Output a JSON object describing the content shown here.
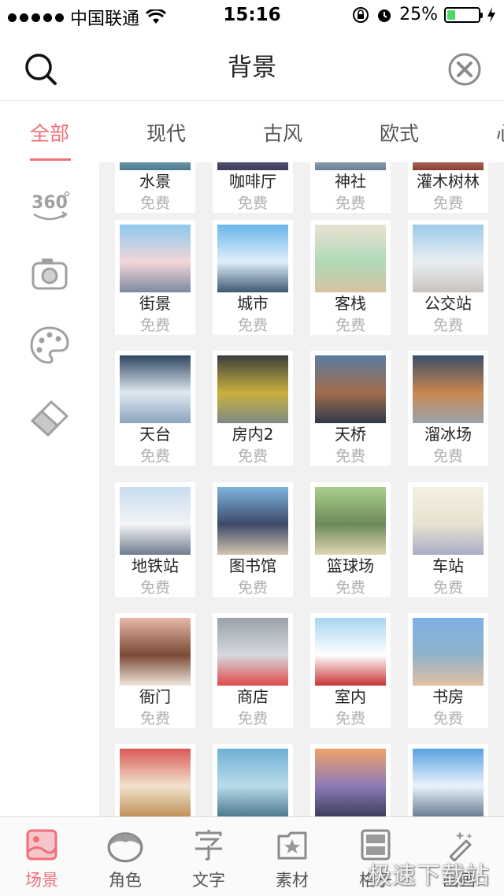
{
  "status_bar": {
    "carrier": "中国联通",
    "time": "15:16",
    "battery": "25%",
    "battery_level": 0.25
  },
  "header": {
    "title": "背景"
  },
  "tabs": [
    {
      "label": "全部",
      "active": true
    },
    {
      "label": "现代",
      "active": false
    },
    {
      "label": "古风",
      "active": false
    },
    {
      "label": "欧式",
      "active": false
    },
    {
      "label": "心",
      "active": false
    }
  ],
  "sidebar": {
    "icons": [
      "360-view-icon",
      "camera-icon",
      "palette-icon",
      "eraser-icon"
    ],
    "label_360": "360"
  },
  "rows": [
    [
      {
        "name": "水景",
        "price": "免费"
      },
      {
        "name": "咖啡厅",
        "price": "免费"
      },
      {
        "name": "神社",
        "price": "免费"
      },
      {
        "name": "灌木树林",
        "price": "免费"
      }
    ],
    [
      {
        "name": "街景",
        "price": "免费"
      },
      {
        "name": "城市",
        "price": "免费"
      },
      {
        "name": "客栈",
        "price": "免费"
      },
      {
        "name": "公交站",
        "price": "免费"
      }
    ],
    [
      {
        "name": "天台",
        "price": "免费"
      },
      {
        "name": "房内2",
        "price": "免费"
      },
      {
        "name": "天桥",
        "price": "免费"
      },
      {
        "name": "溜冰场",
        "price": "免费"
      }
    ],
    [
      {
        "name": "地铁站",
        "price": "免费"
      },
      {
        "name": "图书馆",
        "price": "免费"
      },
      {
        "name": "篮球场",
        "price": "免费"
      },
      {
        "name": "车站",
        "price": "免费"
      }
    ],
    [
      {
        "name": "衙门",
        "price": "免费"
      },
      {
        "name": "商店",
        "price": "免费"
      },
      {
        "name": "室内",
        "price": "免费"
      },
      {
        "name": "书房",
        "price": "免费"
      }
    ],
    [
      {
        "name": "",
        "price": ""
      },
      {
        "name": "",
        "price": ""
      },
      {
        "name": "",
        "price": ""
      },
      {
        "name": "",
        "price": ""
      }
    ]
  ],
  "bottom_nav": [
    {
      "label": "场景",
      "icon": "scene-icon",
      "active": true
    },
    {
      "label": "角色",
      "icon": "character-icon",
      "active": false
    },
    {
      "label": "文字",
      "icon": "text-icon",
      "active": false
    },
    {
      "label": "素材",
      "icon": "material-icon",
      "active": false
    },
    {
      "label": "格子",
      "icon": "grid-icon",
      "active": false
    },
    {
      "label": "画画",
      "icon": "draw-icon",
      "active": false
    }
  ],
  "watermark": "极速下载站",
  "colors": {
    "accent": "#ef6f7a",
    "price_gray": "#b0b0b0",
    "grid_bg": "#f1f1f1"
  }
}
